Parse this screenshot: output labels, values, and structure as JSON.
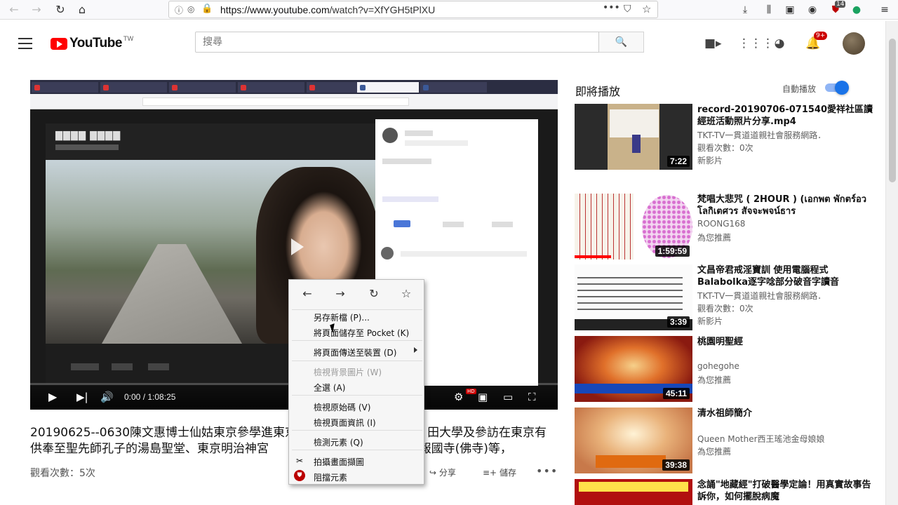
{
  "browser": {
    "url_host": "https://www.youtube.com",
    "url_path": "/watch?v=XfYGH5tPlXU",
    "overflow_badge": "14"
  },
  "youtube": {
    "logo_text": "YouTube",
    "logo_region": "TW",
    "search_placeholder": "搜尋",
    "notification_count": "9+"
  },
  "player": {
    "time_current": "0:00",
    "time_total": "1:08:25",
    "hd_badge": "HD"
  },
  "video": {
    "title_line1": "20190625--0630陳文惠博士仙姑東京參學進東京",
    "title_line1_end": "田大學及參訪在東京有",
    "title_line2": "供奉至聖先師孔子的湯島聖堂、東京明治神宮",
    "title_line2_end": "社)、報國寺(佛寺)等，",
    "views": "觀看次數：5次",
    "share_label": "分享",
    "save_label": "儲存"
  },
  "sidebar": {
    "up_next": "即將播放",
    "autoplay_label": "自動播放",
    "autoplay_on": true,
    "items": [
      {
        "title": "record-20190706-071540愛祥社區讀經班活動照片分享.mp4",
        "channel": "TKT-TV一貫道道親社會服務網路．",
        "meta1": "觀看次數：0次",
        "meta2": "新影片",
        "duration": "7:22"
      },
      {
        "title": "梵唱大悲咒 ( 2HOUR ) (เอกพต พักตร์อวโลกิเตศวร สัจจะพจน์ธาร",
        "channel": "ROONG168",
        "meta1": "為您推薦",
        "meta2": "",
        "duration": "1:59:59"
      },
      {
        "title": "文昌帝君戒淫寶訓 使用電腦程式Balabolka逐字唸部分破音字讀音",
        "channel": "TKT-TV一貫道道親社會服務網路．",
        "meta1": "觀看次數：0次",
        "meta2": "新影片",
        "duration": "3:39"
      },
      {
        "title": "桃園明聖經",
        "channel": "gohegohe",
        "meta1": "為您推薦",
        "meta2": "",
        "duration": "45:11"
      },
      {
        "title": "清水祖師簡介",
        "channel": "Queen Mother西王瑤池金母娘娘",
        "meta1": "為您推薦",
        "meta2": "",
        "duration": "39:38"
      },
      {
        "title": "念誦\"地藏經\"打破醫學定論！用真實故事告訴你，如何擺脫病魔",
        "channel": "",
        "meta1": "",
        "meta2": "",
        "duration": ""
      }
    ]
  },
  "context_menu": {
    "items": [
      {
        "label": "另存新檔 (P)...",
        "disabled": false
      },
      {
        "label": "將頁面儲存至 Pocket (K)",
        "disabled": false
      },
      {
        "label": "將頁面傳送至裝置 (D)",
        "disabled": false
      },
      {
        "label": "檢視背景圖片 (W)",
        "disabled": true
      },
      {
        "label": "全選 (A)",
        "disabled": false
      },
      {
        "label": "檢視原始碼 (V)",
        "disabled": false
      },
      {
        "label": "檢視頁面資訊 (I)",
        "disabled": false
      },
      {
        "label": "檢測元素 (Q)",
        "disabled": false
      },
      {
        "label": "拍攝畫面擷圖",
        "disabled": false
      },
      {
        "label": "阻擋元素",
        "disabled": false
      }
    ]
  },
  "colors": {
    "brand_red": "#ff0000",
    "toggle_blue": "#1a73e8"
  }
}
